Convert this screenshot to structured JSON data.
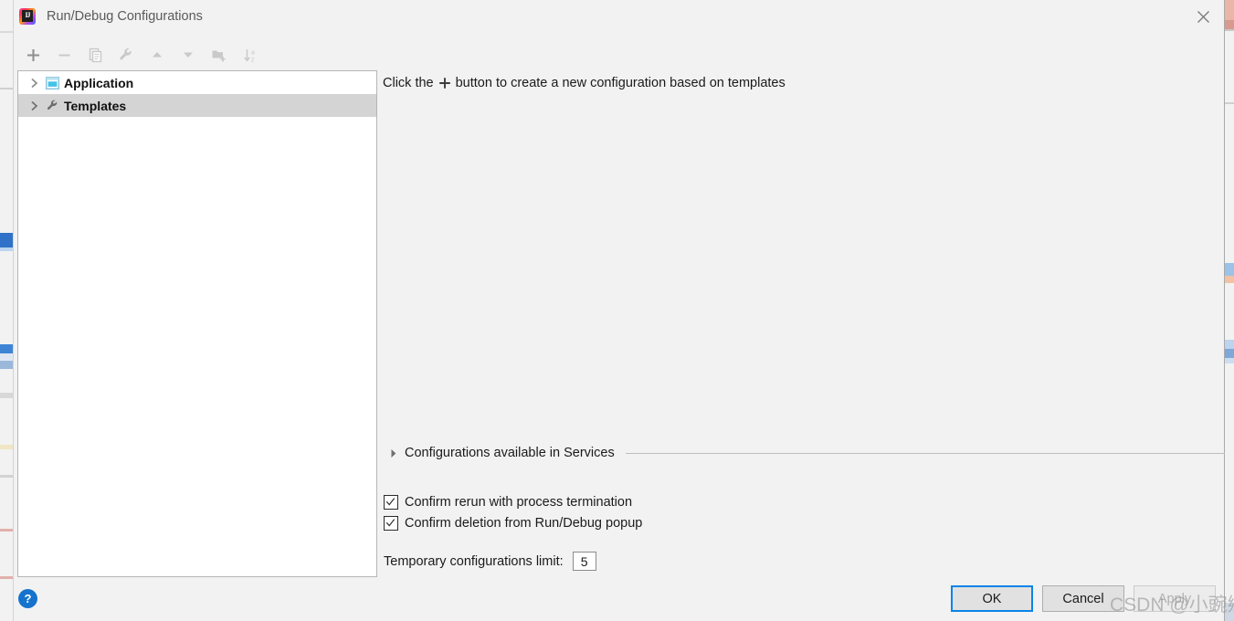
{
  "window": {
    "title": "Run/Debug Configurations",
    "app_icon": "intellij-idea-logo",
    "close_icon": "close-icon"
  },
  "toolbar": {
    "buttons": [
      {
        "name": "add-configuration-button",
        "icon": "plus-icon"
      },
      {
        "name": "remove-configuration-button",
        "icon": "minus-icon"
      },
      {
        "name": "copy-configuration-button",
        "icon": "copy-icon"
      },
      {
        "name": "edit-templates-button",
        "icon": "wrench-icon"
      },
      {
        "name": "move-up-button",
        "icon": "arrow-up-icon"
      },
      {
        "name": "move-down-button",
        "icon": "arrow-down-icon"
      },
      {
        "name": "new-folder-button",
        "icon": "folder-add-icon"
      },
      {
        "name": "sort-configurations-button",
        "icon": "sort-az-icon"
      }
    ]
  },
  "tree": {
    "items": [
      {
        "label": "Application",
        "icon": "application-icon",
        "expanded": false,
        "selected": false
      },
      {
        "label": "Templates",
        "icon": "wrench-icon",
        "expanded": false,
        "selected": true
      }
    ]
  },
  "main": {
    "hint_prefix": "Click the",
    "hint_plus_icon": "plus-icon",
    "hint_suffix": "button to create a new configuration based on templates",
    "services_section_label": "Configurations available in Services",
    "services_section_expanded": false,
    "checkbox_rerun_label": "Confirm rerun with process termination",
    "checkbox_rerun_checked": true,
    "checkbox_delete_label": "Confirm deletion from Run/Debug popup",
    "checkbox_delete_checked": true,
    "limit_label": "Temporary configurations limit:",
    "limit_value": "5"
  },
  "footer": {
    "help_label": "?",
    "ok_label": "OK",
    "cancel_label": "Cancel",
    "apply_label": "Apply"
  },
  "watermark": {
    "text": "CSDN @小豌鄉"
  },
  "colors": {
    "dialog_bg": "#f2f2f2",
    "panel_bg": "#ffffff",
    "selection": "#d4d4d4",
    "accent": "#0a84e8",
    "help_blue": "#1573cd",
    "text": "#1a1a1a",
    "title_text": "#5a5a5a",
    "icon_gray": "#c2c2c2"
  }
}
